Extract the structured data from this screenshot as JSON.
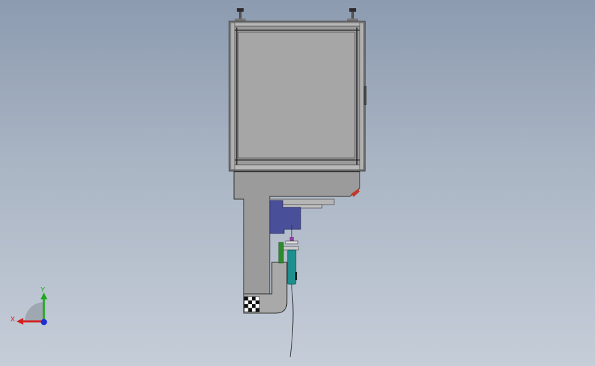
{
  "triad": {
    "x_label": "X",
    "y_label": "Y",
    "x_color": "#d42020",
    "y_color": "#1fa81f",
    "z_color": "#1a2fd6"
  },
  "model": {
    "colors": {
      "frame": "#9a9a9a",
      "panel": "#a6a6a6",
      "frame_dark": "#2a2a2a",
      "clamp": "#4a4f9a",
      "syringe": "#1e8f8f",
      "bracket_green": "#2f8a2f",
      "accent_red": "#c0392b",
      "needle_purple": "#8e3fa0"
    },
    "icons": [
      "leveling-foot-icon",
      "checker-pad-icon",
      "syringe-icon"
    ]
  }
}
